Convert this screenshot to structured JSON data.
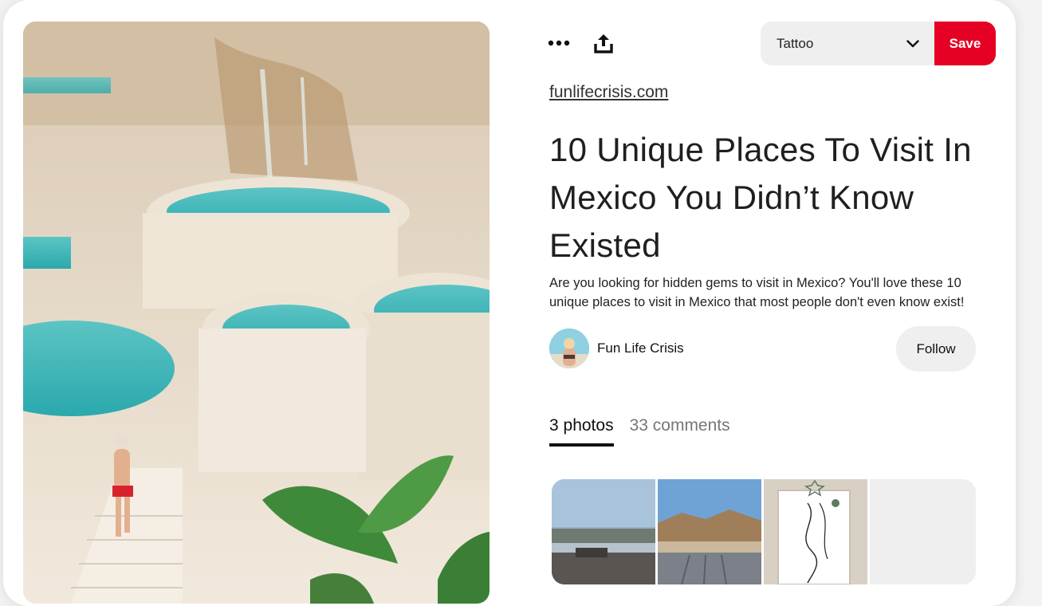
{
  "toolbar": {
    "more_icon": "more-horizontal-icon",
    "share_icon": "share-upload-icon"
  },
  "board_select": {
    "selected": "Tattoo",
    "chevron_icon": "chevron-down-icon"
  },
  "save_button": {
    "label": "Save",
    "color": "#e60023"
  },
  "pin": {
    "source": "funlifecrisis.com",
    "title": "10 Unique Places To Visit In Mexico You Didn’t Know Existed",
    "description": "Are you looking for hidden gems to visit in Mexico? You'll love these 10 unique places to visit in Mexico that most people don't even know exist!"
  },
  "author": {
    "name": "Fun Life Crisis"
  },
  "follow_button": {
    "label": "Follow"
  },
  "tabs": [
    {
      "label": "3 photos",
      "active": true
    },
    {
      "label": "33 comments",
      "active": false
    }
  ]
}
